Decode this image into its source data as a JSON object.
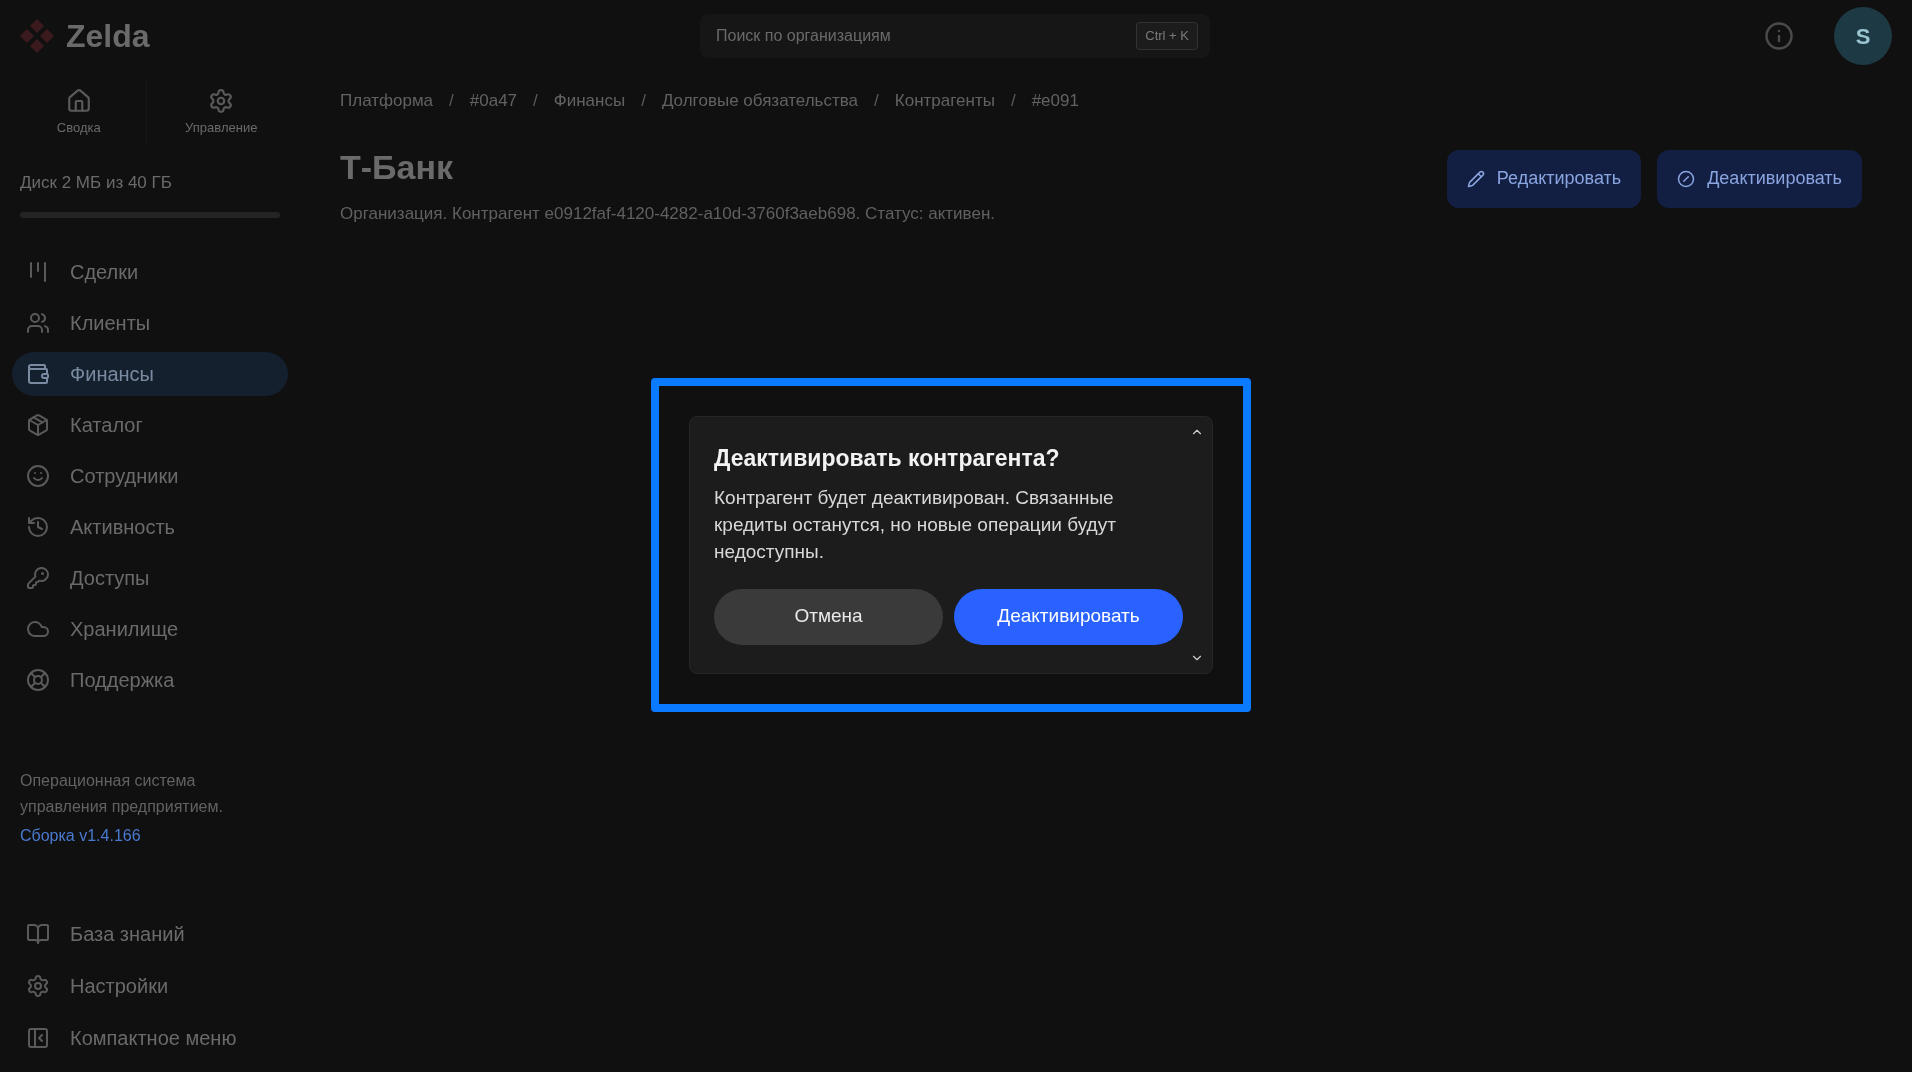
{
  "header": {
    "logo": "Zelda",
    "search": {
      "placeholder": "Поиск по организациям",
      "shortcut": "Ctrl + K"
    },
    "avatar": "S"
  },
  "sidebar": {
    "tabs": [
      "Сводка",
      "Управление"
    ],
    "disk": {
      "label": "Диск 2 МБ из 40 ГБ",
      "level": 0
    },
    "items": [
      {
        "label": "Сделки",
        "selected": false
      },
      {
        "label": "Клиенты",
        "selected": false
      },
      {
        "label": "Финансы",
        "selected": true
      },
      {
        "label": "Каталог",
        "selected": false
      },
      {
        "label": "Сотрудники",
        "selected": false
      },
      {
        "label": "Активность",
        "selected": false
      },
      {
        "label": "Доступы",
        "selected": false
      },
      {
        "label": "Хранилище",
        "selected": false
      },
      {
        "label": "Поддержка",
        "selected": false
      }
    ],
    "about": "Операционная система управления предприятием.",
    "build": "Сборка v1.4.166",
    "bottom_items": [
      "База знаний",
      "Настройки",
      "Компактное меню"
    ]
  },
  "main": {
    "separator": "/",
    "breadcrumbs": [
      "Платформа",
      "#0a47",
      "Финансы",
      "Долговые обязательства",
      "Контрагенты",
      "#e091"
    ],
    "title": "Т-Банк",
    "description": "Организация. Контрагент e0912faf-4120-4282-a10d-3760f3aeb698. Статус: активен.",
    "actions": [
      "Редактировать",
      "Деактивировать"
    ]
  },
  "dialog": {
    "title": "Деактивировать контрагента?",
    "body": "Контрагент будет деактивирован. Связанные кредиты останутся, но новые операции будут недоступны.",
    "buttons": [
      {
        "label": "Отмена",
        "kind": "secondary"
      },
      {
        "label": "Деактивировать",
        "kind": "primary"
      }
    ]
  }
}
